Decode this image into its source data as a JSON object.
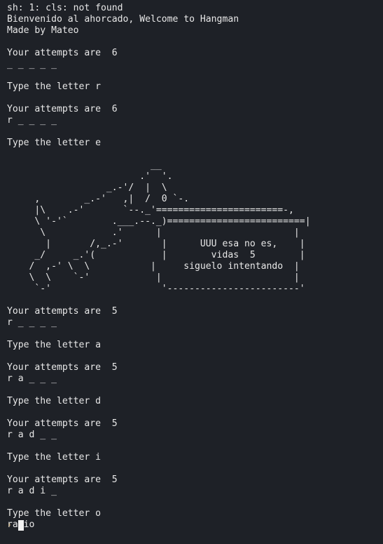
{
  "terminal": {
    "lines": [
      "sh: 1: cls: not found",
      "Bienvenido al ahorcado, Welcome to Hangman",
      "Made by Mateo",
      "",
      "Your attempts are  6",
      "_ _ _ _ _",
      "",
      "Type the letter r",
      "",
      "Your attempts are  6",
      "r _ _ _ _",
      "",
      "Type the letter e",
      "",
      "                          __",
      "                        .'  '.",
      "                  _.-'/  |  \\",
      "     ,        _.-'   ,|  /  0 `-.",
      "     |\\    .-'       `--._'=======================-,",
      "     \\ '-'`        .___.--._)=========================|",
      "      \\            .'      |                        |",
      "       |       /,_.-'       |      UUU esa no es,    |",
      "     _/     _.'(            |        vidas  5        |",
      "    /  ,-' \\  \\           |     siguelo intentando  |",
      "    \\  \\    `-'            |                        |",
      "     `-'                    '------------------------'",
      "",
      "Your attempts are  5",
      "r _ _ _ _",
      "",
      "Type the letter a",
      "",
      "Your attempts are  5",
      "r a _ _ _",
      "",
      "Type the letter d",
      "",
      "Your attempts are  5",
      "r a d _ _",
      "",
      "Type the letter i",
      "",
      "Your attempts are  5",
      "r a d i _",
      "",
      "Type the letter o",
      "radio"
    ],
    "prompt_symbol": "›"
  },
  "colors": {
    "background": "#1e2127",
    "text": "#e8e8e8",
    "prompt": "#e5c07b",
    "cursor": "#f2f2f2"
  }
}
